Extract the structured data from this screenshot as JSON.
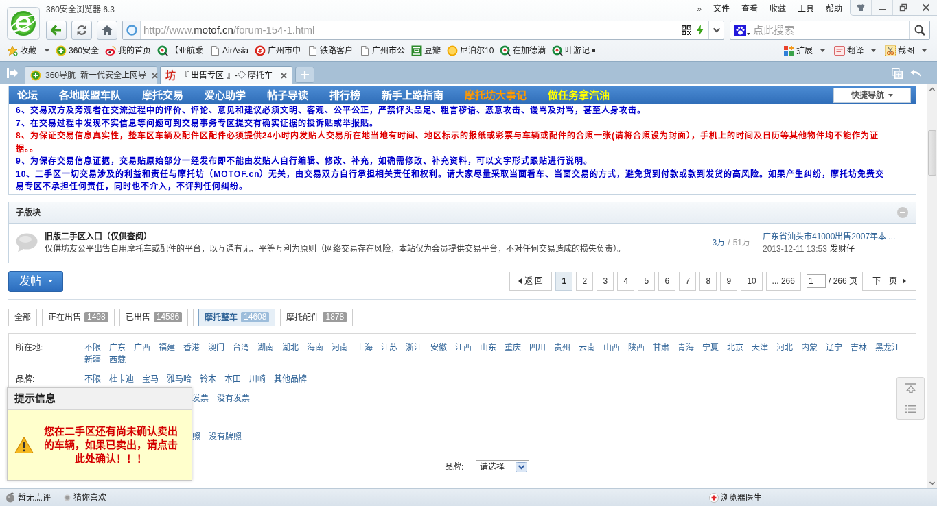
{
  "window": {
    "title": "360安全浏览器 6.3",
    "more": "»",
    "menu": [
      "文件",
      "查看",
      "收藏",
      "工具",
      "帮助"
    ]
  },
  "address_bar": {
    "url_prefix": "http://www.",
    "url_host": "motof.cn",
    "url_path": "/forum-154-1.html"
  },
  "search": {
    "placeholder": "点此搜索"
  },
  "bookmarks": {
    "favorites": "收藏",
    "items": [
      {
        "label": "360安全",
        "kind": "plus"
      },
      {
        "label": "我的首页",
        "kind": "eye"
      },
      {
        "label": "【亚航乘",
        "kind": "ring"
      },
      {
        "label": "AirAsia",
        "kind": "page"
      },
      {
        "label": "广州市中",
        "kind": "emblem"
      },
      {
        "label": "铁路客户",
        "kind": "page"
      },
      {
        "label": "广州市公",
        "kind": "page"
      },
      {
        "label": "豆瓣",
        "kind": "tile"
      },
      {
        "label": "尼泊尔10",
        "kind": "coin"
      },
      {
        "label": "在加德满",
        "kind": "ring"
      },
      {
        "label": "叶游记",
        "kind": "ring"
      }
    ],
    "tools": [
      {
        "label": "扩展",
        "kind": "grid"
      },
      {
        "label": "翻译",
        "kind": "dictionary"
      },
      {
        "label": "截图",
        "kind": "scissors"
      }
    ]
  },
  "tabs": [
    {
      "label": "360导航_新一代安全上网导",
      "selected": false,
      "kind": "plus"
    },
    {
      "label": "『 出售专区 』-◇ 摩托车",
      "selected": true,
      "kind": "glyph",
      "glyph": "坊"
    }
  ],
  "forum_nav": {
    "items": [
      {
        "label": "论坛",
        "color": "#ffffff"
      },
      {
        "label": "各地联盟车队",
        "color": "#ffffff"
      },
      {
        "label": "摩托交易",
        "color": "#ffffff"
      },
      {
        "label": "爱心助学",
        "color": "#ffffff"
      },
      {
        "label": "帖子导读",
        "color": "#ffffff"
      },
      {
        "label": "排行榜",
        "color": "#ffffff"
      },
      {
        "label": "新手上路指南",
        "color": "#ffffff"
      },
      {
        "label": "摩托坊大事记",
        "color": "#ff9900"
      },
      {
        "label": "做任务拿汽油",
        "color": "#ffff00"
      }
    ],
    "quick_nav": "快捷导航"
  },
  "rules": [
    {
      "text": "6、交易双方及旁观者在交流过程中的评价、评论、意见和建议必须文明、客观、公平公正，严禁评头品足、粗言秽语、恶意攻击、谩骂及对骂，甚至人身攻击。",
      "color": "#0000cc"
    },
    {
      "text": "7、在交易过程中发现不实信息等问题可到交易事务专区提交有确实证据的投诉贴或举报贴。",
      "color": "#0000cc"
    },
    {
      "text": "8、为保证交易信息真实性，整车区车辆及配件区配件必须提供24小时内发贴人交易所在地当地有时间、地区标示的报纸或彩票与车辆或配件的合照一张(请将合照设为封面），手机上的时间及日历等其他物件均不能作为证据。。",
      "color": "#e00000"
    },
    {
      "text": "9、为保存交易信息证据，交易贴原始部分一经发布即不能由发贴人自行编辑、修改、补充，如确需修改、补充资料，可以文字形式跟贴进行说明。",
      "color": "#0000cc"
    },
    {
      "text": "10、二手区一切交易涉及的利益和责任与摩托坊（MOTOF.cn）无关，由交易双方自行承担相关责任和权利。请大家尽量采取当面看车、当面交易的方式，避免货到付款或款到发货的高风险。如果产生纠纷，摩托坊免费交易专区不承担任何责任，同时也不介入，不评判任何纠纷。",
      "color": "#0000cc"
    }
  ],
  "subforums": {
    "title": "子版块",
    "items": [
      {
        "name": "旧版二手区入口（仅供查阅）",
        "description": "仅供坊友公平出售自用摩托车或配件的平台，以互通有无、平等互利为原则（网络交易存在风险，本站仅为会员提供交易平台，不对任何交易造成的损失负责）。",
        "threads": "3万",
        "separator": "/",
        "posts": "51万",
        "last_post": {
          "title": "广东省汕头市41000出售2007年本 ...",
          "time": "2013-12-11 13:53",
          "author": "发财仔"
        }
      }
    ]
  },
  "post_button": "发帖",
  "pagination": {
    "back": "返 回",
    "pages": [
      {
        "label": "1",
        "selected": true
      },
      {
        "label": "2",
        "selected": false
      },
      {
        "label": "3",
        "selected": false
      },
      {
        "label": "4",
        "selected": false
      },
      {
        "label": "5",
        "selected": false
      },
      {
        "label": "6",
        "selected": false
      },
      {
        "label": "7",
        "selected": false
      },
      {
        "label": "8",
        "selected": false
      },
      {
        "label": "9",
        "selected": false
      },
      {
        "label": "10",
        "selected": false
      },
      {
        "label": "... 266",
        "selected": false
      }
    ],
    "jump_value": "1",
    "total": "/ 266 页",
    "next": "下一页"
  },
  "status_tabs": [
    {
      "label": "全部",
      "selected": false
    },
    {
      "label": "正在出售",
      "count": "1498",
      "selected": false
    },
    {
      "label": "已出售",
      "count": "14586",
      "selected": false
    }
  ],
  "category_tabs": [
    {
      "label": "摩托整车",
      "count": "14608",
      "selected": true
    },
    {
      "label": "摩托配件",
      "count": "1878",
      "selected": false
    }
  ],
  "filters": [
    {
      "label": "所在地:",
      "options": [
        "不限",
        "广东",
        "广西",
        "福建",
        "香港",
        "澳门",
        "台湾",
        "湖南",
        "湖北",
        "海南",
        "河南",
        "上海",
        "江苏",
        "浙江",
        "安徽",
        "江西",
        "山东",
        "重庆",
        "四川",
        "贵州",
        "云南",
        "山西",
        "陕西",
        "甘肃",
        "青海",
        "宁夏",
        "北京",
        "天津",
        "河北",
        "内蒙",
        "辽宁",
        "吉林",
        "黑龙江",
        "新疆",
        "西藏"
      ]
    },
    {
      "label": "品牌:",
      "options": [
        "不限",
        "杜卡迪",
        "宝马",
        "雅马哈",
        "铃木",
        "本田",
        "川崎",
        "其他品牌"
      ]
    },
    {
      "options": [
        "发票",
        "没有发票"
      ]
    },
    {
      "options": [
        "照",
        "没有牌照"
      ]
    }
  ],
  "selects": [
    {
      "label": "品牌:",
      "value": "请选择"
    }
  ],
  "notice": {
    "title": "提示信息",
    "message": "您在二手区还有尚未确认卖出的车辆，如果已卖出，请点击此处确认！！！"
  },
  "status_bar": {
    "left": [
      {
        "label": "暂无点评",
        "kind": "fruit"
      },
      {
        "label": "猜你喜欢",
        "kind": "dot"
      }
    ],
    "right": [
      {
        "label": "浏览器医生",
        "kind": "cross"
      }
    ]
  }
}
